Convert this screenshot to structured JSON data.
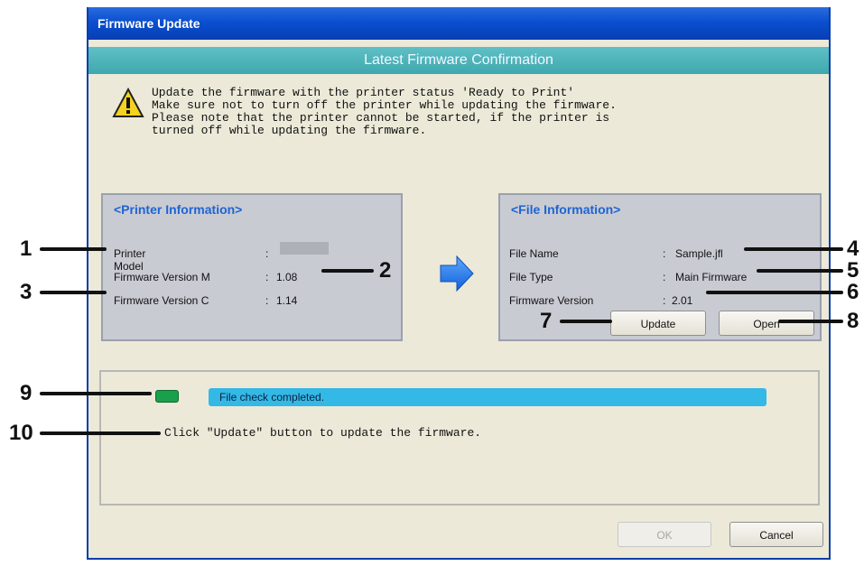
{
  "window": {
    "title": "Firmware Update",
    "banner": "Latest Firmware Confirmation"
  },
  "warning": {
    "lines": [
      "Update the firmware with the printer status 'Ready to Print'",
      "Make sure not to turn off the printer while updating the firmware.",
      "Please note that the printer cannot be started, if the printer is",
      "turned off while updating the firmware."
    ]
  },
  "printer_info": {
    "heading": "<Printer Information>",
    "rows": [
      {
        "label": "Printer Model",
        "value": ""
      },
      {
        "label": "Firmware Version M",
        "value": "1.08"
      },
      {
        "label": "Firmware Version C",
        "value": "1.14"
      }
    ]
  },
  "file_info": {
    "heading": "<File Information>",
    "rows": [
      {
        "label": "File Name",
        "value": "Sample.jfl"
      },
      {
        "label": "File Type",
        "value": "Main Firmware"
      },
      {
        "label": "Firmware Version",
        "value": "2.01"
      }
    ],
    "update_label": "Update",
    "open_label": "Open"
  },
  "status": {
    "progress_text": "File check completed.",
    "message": "Click \"Update\" button to update the firmware.",
    "led_color": "#1aa04b"
  },
  "footer": {
    "ok_label": "OK",
    "cancel_label": "Cancel"
  },
  "callouts": {
    "c1": "1",
    "c2": "2",
    "c3": "3",
    "c4": "4",
    "c5": "5",
    "c6": "6",
    "c7": "7",
    "c8": "8",
    "c9": "9",
    "c10": "10"
  },
  "colors": {
    "title_bar": "#0a4fd0",
    "banner": "#3ea8ae",
    "heading": "#1e64d2",
    "progress": "#34b8e6"
  },
  "icons": [
    "warning-icon",
    "arrow-right-icon"
  ]
}
